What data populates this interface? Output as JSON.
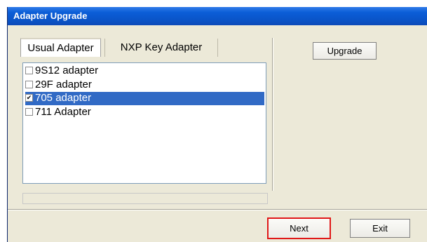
{
  "window": {
    "title": "Adapter Upgrade"
  },
  "tabs": [
    {
      "label": "Usual Adapter",
      "active": true
    },
    {
      "label": "NXP Key Adapter",
      "active": false
    }
  ],
  "adapters": [
    {
      "label": "9S12 adapter",
      "checked": false,
      "selected": false
    },
    {
      "label": "29F adapter",
      "checked": false,
      "selected": false
    },
    {
      "label": "705 adapter",
      "checked": true,
      "selected": true
    },
    {
      "label": "711 Adapter",
      "checked": false,
      "selected": false
    }
  ],
  "buttons": {
    "upgrade": "Upgrade",
    "next": "Next",
    "exit": "Exit"
  },
  "progress": {
    "value": 0
  },
  "colors": {
    "titlebar": "#0b5ed7",
    "selection": "#316ac5",
    "highlight_border": "#e01818",
    "window_bg": "#ece9d8"
  },
  "icons": {
    "checkbox_checked": "✔"
  }
}
